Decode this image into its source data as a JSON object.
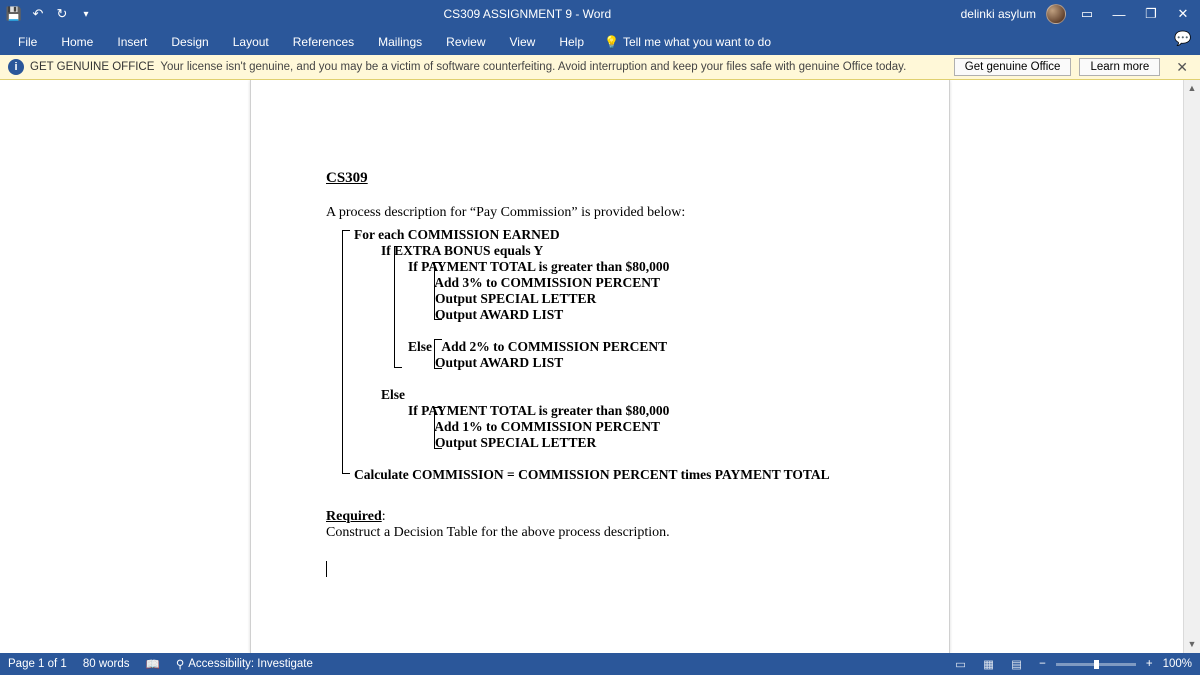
{
  "title": "CS309 ASSIGNMENT 9  -  Word",
  "user": "delinki asylum",
  "menu": [
    "File",
    "Home",
    "Insert",
    "Design",
    "Layout",
    "References",
    "Mailings",
    "Review",
    "View",
    "Help"
  ],
  "tell_me": "Tell me what you want to do",
  "banner": {
    "title": "GET GENUINE OFFICE",
    "msg": "Your license isn't genuine, and you may be a victim of software counterfeiting. Avoid interruption and keep your files safe with genuine Office today.",
    "btn1": "Get genuine Office",
    "btn2": "Learn more"
  },
  "doc": {
    "heading": "CS309",
    "intro": "A process description for “Pay Commission” is provided below:",
    "l1": "For each COMMISSION EARNED",
    "l2": "        If EXTRA BONUS equals Y",
    "l3": "                If PAYMENT TOTAL is greater than $80,000",
    "l4": "                        Add 3% to COMMISSION PERCENT",
    "l5": "                        Output SPECIAL LETTER",
    "l6": "                        Output AWARD LIST",
    "l7": " ",
    "l8": "                Else   Add 2% to COMMISSION PERCENT",
    "l9": "                        Output AWARD LIST",
    "l10": " ",
    "l11": "        Else",
    "l12": "                If PAYMENT TOTAL is greater than $80,000",
    "l13": "                        Add 1% to COMMISSION PERCENT",
    "l14": "                        Output SPECIAL LETTER",
    "l15": " ",
    "l16": "Calculate COMMISSION = COMMISSION PERCENT times PAYMENT TOTAL",
    "req_title": "Required",
    "req_body": "Construct a Decision Table for the above process description."
  },
  "status": {
    "page": "Page 1 of 1",
    "words": "80 words",
    "acc": "Accessibility: Investigate",
    "zoom": "100%"
  }
}
